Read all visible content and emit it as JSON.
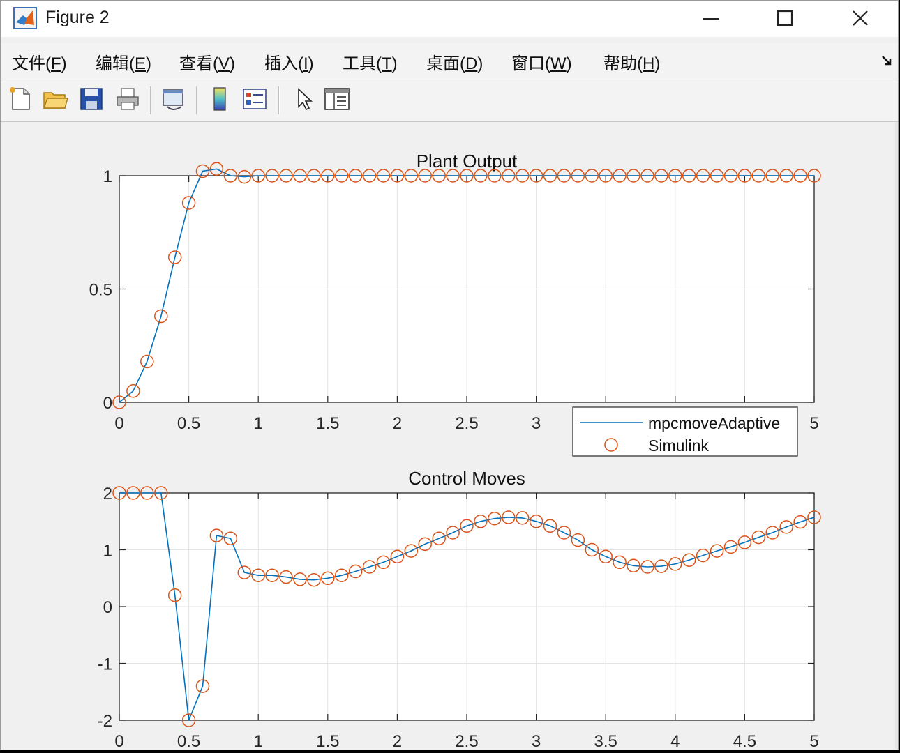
{
  "window": {
    "title": "Figure 2",
    "icon": "matlab-icon"
  },
  "menu": [
    {
      "text": "文件(",
      "key": "F",
      "after": ")"
    },
    {
      "text": "编辑(",
      "key": "E",
      "after": ")"
    },
    {
      "text": "查看(",
      "key": "V",
      "after": ")"
    },
    {
      "text": "插入(",
      "key": "I",
      "after": ")"
    },
    {
      "text": "工具(",
      "key": "T",
      "after": ")"
    },
    {
      "text": "桌面(",
      "key": "D",
      "after": ")"
    },
    {
      "text": "窗口(",
      "key": "W",
      "after": ")"
    },
    {
      "text": "帮助(",
      "key": "H",
      "after": ")"
    }
  ],
  "toolbar": [
    "new-file-icon",
    "open-folder-icon",
    "save-icon",
    "print-icon",
    "link-figure-icon",
    "colorbar-icon",
    "legend-icon",
    "pointer-icon",
    "property-inspector-icon"
  ],
  "chart_data": [
    {
      "type": "line",
      "title": "Plant Output",
      "xlim": [
        0,
        5
      ],
      "ylim": [
        0,
        1
      ],
      "xticks": [
        "0",
        "0.5",
        "1",
        "1.5",
        "2",
        "2.5",
        "3",
        "3.5",
        "4",
        "4.5",
        "5"
      ],
      "yticks": [
        "0",
        "0.5",
        "1"
      ],
      "grid": true,
      "legend": {
        "position": "bottom-right",
        "entries": [
          "mpcmoveAdaptive",
          "Simulink"
        ]
      },
      "x": [
        0,
        0.1,
        0.2,
        0.3,
        0.4,
        0.5,
        0.6,
        0.7,
        0.8,
        0.9,
        1.0,
        1.1,
        1.2,
        1.3,
        1.4,
        1.5,
        1.6,
        1.7,
        1.8,
        1.9,
        2.0,
        2.1,
        2.2,
        2.3,
        2.4,
        2.5,
        2.6,
        2.7,
        2.8,
        2.9,
        3.0,
        3.1,
        3.2,
        3.3,
        3.4,
        3.5,
        3.6,
        3.7,
        3.8,
        3.9,
        4.0,
        4.1,
        4.2,
        4.3,
        4.4,
        4.5,
        4.6,
        4.7,
        4.8,
        4.9,
        5.0
      ],
      "series": [
        {
          "name": "mpcmoveAdaptive",
          "style": "line",
          "color": "#0072bd",
          "values": [
            0,
            0.05,
            0.18,
            0.38,
            0.64,
            0.88,
            1.02,
            1.03,
            1.0,
            0.995,
            1.0,
            1.0,
            1.0,
            1.0,
            1.0,
            1.0,
            1.0,
            1.0,
            1.0,
            1.0,
            1.0,
            1.0,
            1.0,
            1.0,
            1.0,
            1.0,
            1.0,
            1.0,
            1.0,
            1.0,
            1.0,
            1.0,
            1.0,
            1.0,
            1.0,
            1.0,
            1.0,
            1.0,
            1.0,
            1.0,
            1.0,
            1.0,
            1.0,
            1.0,
            1.0,
            1.0,
            1.0,
            1.0,
            1.0,
            1.0,
            1.0
          ]
        },
        {
          "name": "Simulink",
          "style": "circle",
          "color": "#d95319",
          "values": [
            0,
            0.05,
            0.18,
            0.38,
            0.64,
            0.88,
            1.02,
            1.03,
            1.0,
            0.995,
            1.0,
            1.0,
            1.0,
            1.0,
            1.0,
            1.0,
            1.0,
            1.0,
            1.0,
            1.0,
            1.0,
            1.0,
            1.0,
            1.0,
            1.0,
            1.0,
            1.0,
            1.0,
            1.0,
            1.0,
            1.0,
            1.0,
            1.0,
            1.0,
            1.0,
            1.0,
            1.0,
            1.0,
            1.0,
            1.0,
            1.0,
            1.0,
            1.0,
            1.0,
            1.0,
            1.0,
            1.0,
            1.0,
            1.0,
            1.0,
            1.0
          ]
        }
      ]
    },
    {
      "type": "line",
      "title": "Control Moves",
      "xlim": [
        0,
        5
      ],
      "ylim": [
        -2,
        2
      ],
      "xticks": [
        "0",
        "0.5",
        "1",
        "1.5",
        "2",
        "2.5",
        "3",
        "3.5",
        "4",
        "4.5",
        "5"
      ],
      "yticks": [
        "-2",
        "-1",
        "0",
        "1",
        "2"
      ],
      "grid": true,
      "x": [
        0,
        0.1,
        0.2,
        0.3,
        0.4,
        0.5,
        0.6,
        0.7,
        0.8,
        0.9,
        1.0,
        1.1,
        1.2,
        1.3,
        1.4,
        1.5,
        1.6,
        1.7,
        1.8,
        1.9,
        2.0,
        2.1,
        2.2,
        2.3,
        2.4,
        2.5,
        2.6,
        2.7,
        2.8,
        2.9,
        3.0,
        3.1,
        3.2,
        3.3,
        3.4,
        3.5,
        3.6,
        3.7,
        3.8,
        3.9,
        4.0,
        4.1,
        4.2,
        4.3,
        4.4,
        4.5,
        4.6,
        4.7,
        4.8,
        4.9,
        5.0
      ],
      "series": [
        {
          "name": "mpcmoveAdaptive",
          "style": "line",
          "color": "#0072bd",
          "values": [
            2,
            2,
            2,
            2,
            0.2,
            -2,
            -1.4,
            1.25,
            1.2,
            0.6,
            0.55,
            0.55,
            0.52,
            0.48,
            0.47,
            0.5,
            0.55,
            0.62,
            0.7,
            0.78,
            0.88,
            0.98,
            1.1,
            1.2,
            1.3,
            1.42,
            1.5,
            1.55,
            1.57,
            1.56,
            1.5,
            1.42,
            1.3,
            1.17,
            1.0,
            0.88,
            0.78,
            0.72,
            0.7,
            0.71,
            0.75,
            0.82,
            0.9,
            0.98,
            1.05,
            1.13,
            1.22,
            1.3,
            1.4,
            1.49,
            1.57
          ]
        },
        {
          "name": "Simulink",
          "style": "circle",
          "color": "#d95319",
          "values": [
            2,
            2,
            2,
            2,
            0.2,
            -2,
            -1.4,
            1.25,
            1.2,
            0.6,
            0.55,
            0.55,
            0.52,
            0.48,
            0.47,
            0.5,
            0.55,
            0.62,
            0.7,
            0.78,
            0.88,
            0.98,
            1.1,
            1.2,
            1.3,
            1.42,
            1.5,
            1.55,
            1.57,
            1.56,
            1.5,
            1.42,
            1.3,
            1.17,
            1.0,
            0.88,
            0.78,
            0.72,
            0.7,
            0.71,
            0.75,
            0.82,
            0.9,
            0.98,
            1.05,
            1.13,
            1.22,
            1.3,
            1.4,
            1.49,
            1.57
          ]
        }
      ]
    }
  ]
}
